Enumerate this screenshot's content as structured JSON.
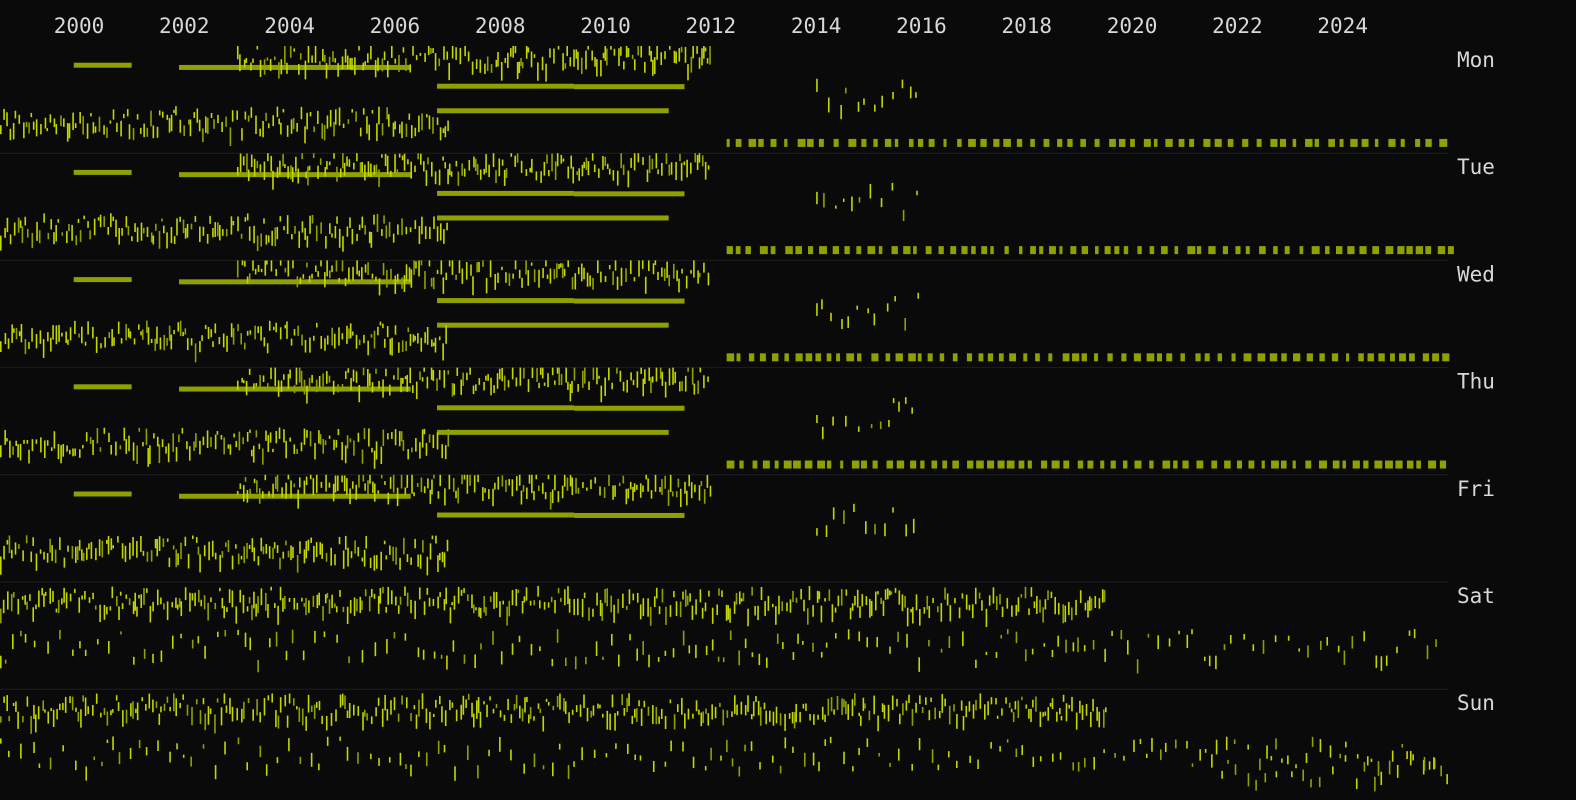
{
  "chart_data": {
    "type": "heatmap",
    "title": "",
    "xlabel": "",
    "ylabel": "",
    "x_range": [
      1998.5,
      2026.0
    ],
    "year_ticks": [
      "2000",
      "2002",
      "2004",
      "2006",
      "2008",
      "2010",
      "2012",
      "2014",
      "2016",
      "2018",
      "2020",
      "2022",
      "2024"
    ],
    "rows": [
      "Mon",
      "Tue",
      "Wed",
      "Thu",
      "Fri",
      "Sat",
      "Sun"
    ],
    "y_within_row": "time of day, 0:00 (top) to 24:00 (bottom)",
    "mark_color": "#c4d600",
    "dim_mark_color": "#8fa000",
    "background_color": "#0a0a0a",
    "grid": false,
    "legend": "none",
    "activity_bands": [
      {
        "rows": [
          "Mon",
          "Tue",
          "Wed",
          "Thu",
          "Fri"
        ],
        "kind": "steady",
        "start": 2006.8,
        "end": 2009.4,
        "time": 9.0
      },
      {
        "rows": [
          "Mon",
          "Tue",
          "Wed",
          "Thu",
          "Fri"
        ],
        "kind": "steady",
        "start": 2009.4,
        "end": 2011.5,
        "time": 9.1
      },
      {
        "rows": [
          "Mon",
          "Tue",
          "Wed",
          "Thu"
        ],
        "kind": "steady",
        "start": 2006.8,
        "end": 2011.2,
        "time": 14.5
      },
      {
        "rows": [
          "Mon",
          "Tue",
          "Wed",
          "Thu",
          "Fri"
        ],
        "kind": "steady",
        "start": 1999.9,
        "end": 2001.0,
        "time": 4.3
      },
      {
        "rows": [
          "Mon",
          "Tue",
          "Wed",
          "Thu",
          "Fri"
        ],
        "kind": "steady",
        "start": 2001.9,
        "end": 2006.3,
        "time": 4.8
      },
      {
        "rows": [
          "Mon",
          "Tue",
          "Wed",
          "Thu"
        ],
        "kind": "dotted",
        "start": 2012.3,
        "end": 2026.0,
        "time": 21.7
      },
      {
        "rows": [
          "Mon",
          "Tue",
          "Wed",
          "Thu",
          "Fri"
        ],
        "kind": "dense",
        "start": 2003.0,
        "end": 2012.0,
        "time": 1.5
      },
      {
        "rows": [
          "Mon",
          "Tue",
          "Wed",
          "Thu",
          "Fri"
        ],
        "kind": "dense",
        "start": 1998.5,
        "end": 2007.0,
        "time": 16.0
      },
      {
        "rows": [
          "Mon",
          "Tue",
          "Wed",
          "Thu",
          "Fri"
        ],
        "kind": "sparse",
        "start": 2014.0,
        "end": 2016.0,
        "time": 10.0
      },
      {
        "rows": [
          "Sat",
          "Sun"
        ],
        "kind": "dense",
        "start": 1998.5,
        "end": 2019.5,
        "time": 3.5
      },
      {
        "rows": [
          "Sat",
          "Sun"
        ],
        "kind": "sparse",
        "start": 1998.5,
        "end": 2026.0,
        "time": 14.0
      },
      {
        "rows": [
          "Sun"
        ],
        "kind": "sparse",
        "start": 2021.5,
        "end": 2026.0,
        "time": 17.0
      }
    ]
  }
}
